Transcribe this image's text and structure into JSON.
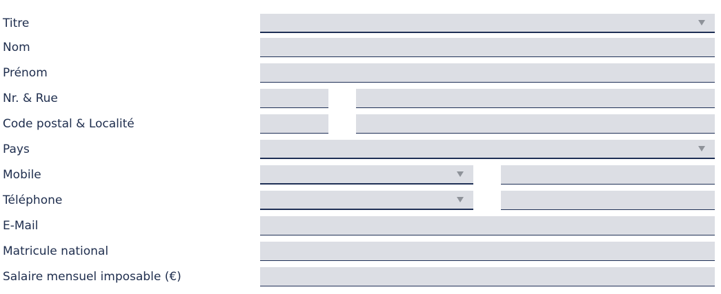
{
  "form": {
    "titre": {
      "label": "Titre",
      "value": ""
    },
    "nom": {
      "label": "Nom",
      "value": ""
    },
    "prenom": {
      "label": "Prénom",
      "value": ""
    },
    "rue": {
      "label": "Nr. & Rue",
      "number": "",
      "street": ""
    },
    "localite": {
      "label": "Code postal & Localité",
      "postal_code": "",
      "city": ""
    },
    "pays": {
      "label": "Pays",
      "value": ""
    },
    "mobile": {
      "label": "Mobile",
      "prefix": "",
      "number": ""
    },
    "telephone": {
      "label": "Téléphone",
      "prefix": "",
      "number": ""
    },
    "email": {
      "label": "E-Mail",
      "value": ""
    },
    "matricule": {
      "label": "Matricule national",
      "value": ""
    },
    "salaire": {
      "label": "Salaire mensuel imposable (€)",
      "value": ""
    }
  },
  "style": {
    "field_background": "#dcdee4",
    "field_underline": "#1e2f55",
    "label_color": "#1e2d4d",
    "caret_color": "#8e9299"
  },
  "icons": {
    "dropdown": "chevron-down-icon"
  }
}
